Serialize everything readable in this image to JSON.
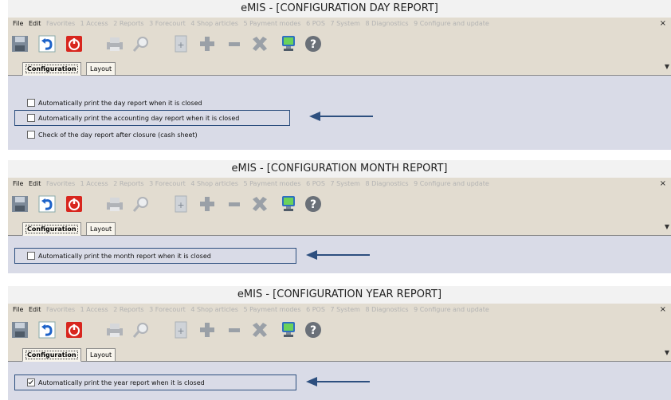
{
  "menu_items": [
    {
      "label": "File",
      "enabled": true
    },
    {
      "label": "Edit",
      "enabled": true
    },
    {
      "label": "Favorites",
      "enabled": false
    },
    {
      "label": "1 Access",
      "enabled": false
    },
    {
      "label": "2 Reports",
      "enabled": false
    },
    {
      "label": "3 Forecourt",
      "enabled": false
    },
    {
      "label": "4 Shop articles",
      "enabled": false
    },
    {
      "label": "5 Payment modes",
      "enabled": false
    },
    {
      "label": "6 POS",
      "enabled": false
    },
    {
      "label": "7 System",
      "enabled": false
    },
    {
      "label": "8 Diagnostics",
      "enabled": false
    },
    {
      "label": "9 Configure and update",
      "enabled": false
    }
  ],
  "close_glyph": "×",
  "toolbar_icons": [
    "save-icon",
    "undo-icon",
    "power-icon",
    "print-icon",
    "search-icon",
    "new-doc-icon",
    "add-icon",
    "remove-icon",
    "delete-icon",
    "computer-icon",
    "help-icon"
  ],
  "tabs": [
    "Configuration",
    "Layout"
  ],
  "colors": {
    "highlight": "#2d4f7f",
    "arrow": "#2d4f7f",
    "menu_bg": "#e2dcd0",
    "content_bg": "#d9dbe7"
  },
  "panels": [
    {
      "title": "eMIS - [CONFIGURATION DAY REPORT]",
      "tabs": [
        "Configuration",
        "Layout"
      ],
      "options": [
        {
          "label": "Automatically print the day report when it is closed",
          "checked": false
        },
        {
          "label": "Automatically print the accounting day report when it is closed",
          "checked": false,
          "highlighted": true
        },
        {
          "label": "Check of the day report after closure (cash sheet)",
          "checked": false
        }
      ]
    },
    {
      "title": "eMIS - [CONFIGURATION MONTH REPORT]",
      "tabs": [
        "Configuration",
        "Layout"
      ],
      "options": [
        {
          "label": "Automatically print the month report when it is closed",
          "checked": false,
          "highlighted": true
        }
      ]
    },
    {
      "title": "eMIS - [CONFIGURATION YEAR REPORT]",
      "tabs": [
        "Configuration",
        "Layout"
      ],
      "options": [
        {
          "label": "Automatically print the year report when it is closed",
          "checked": true,
          "highlighted": true
        }
      ]
    }
  ]
}
